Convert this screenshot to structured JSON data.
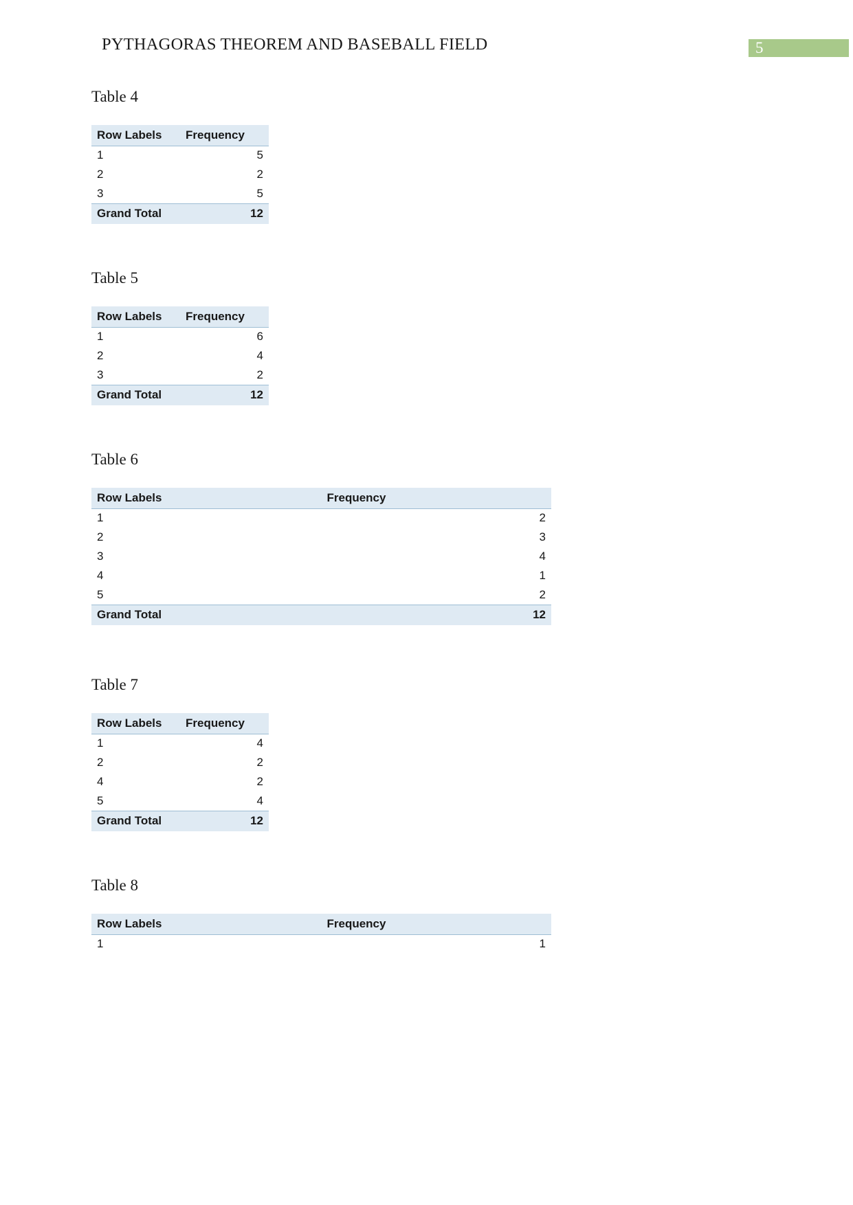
{
  "header": {
    "running_title": "PYTHAGORAS THEOREM AND BASEBALL FIELD",
    "page_number": "5",
    "badge_color": "#a8c98a"
  },
  "theme": {
    "table_header_bg": "#dfeaf3",
    "table_rule_color": "#9dbdd4",
    "text_color": "#181818"
  },
  "tables": [
    {
      "caption": "Table 4",
      "width": "narrow",
      "columns": [
        "Row Labels",
        "Frequency"
      ],
      "rows": [
        {
          "label": "1",
          "value": "5"
        },
        {
          "label": "2",
          "value": "2"
        },
        {
          "label": "3",
          "value": "5"
        }
      ],
      "total": {
        "label": "Grand Total",
        "value": "12"
      }
    },
    {
      "caption": "Table 5",
      "width": "narrow",
      "columns": [
        "Row Labels",
        "Frequency"
      ],
      "rows": [
        {
          "label": "1",
          "value": "6"
        },
        {
          "label": "2",
          "value": "4"
        },
        {
          "label": "3",
          "value": "2"
        }
      ],
      "total": {
        "label": "Grand Total",
        "value": "12"
      }
    },
    {
      "caption": "Table 6",
      "width": "wide",
      "columns": [
        "Row Labels",
        "Frequency"
      ],
      "rows": [
        {
          "label": "1",
          "value": "2"
        },
        {
          "label": "2",
          "value": "3"
        },
        {
          "label": "3",
          "value": "4"
        },
        {
          "label": "4",
          "value": "1"
        },
        {
          "label": "5",
          "value": "2"
        }
      ],
      "total": {
        "label": "Grand Total",
        "value": "12"
      }
    },
    {
      "caption": "Table 7",
      "width": "narrow",
      "columns": [
        "Row Labels",
        "Frequency"
      ],
      "rows": [
        {
          "label": "1",
          "value": "4"
        },
        {
          "label": "2",
          "value": "2"
        },
        {
          "label": "4",
          "value": "2"
        },
        {
          "label": "5",
          "value": "4"
        }
      ],
      "total": {
        "label": "Grand Total",
        "value": "12"
      }
    },
    {
      "caption": "Table 8",
      "width": "wide",
      "columns": [
        "Row Labels",
        "Frequency"
      ],
      "rows": [
        {
          "label": "1",
          "value": "1"
        }
      ],
      "total": null
    }
  ]
}
